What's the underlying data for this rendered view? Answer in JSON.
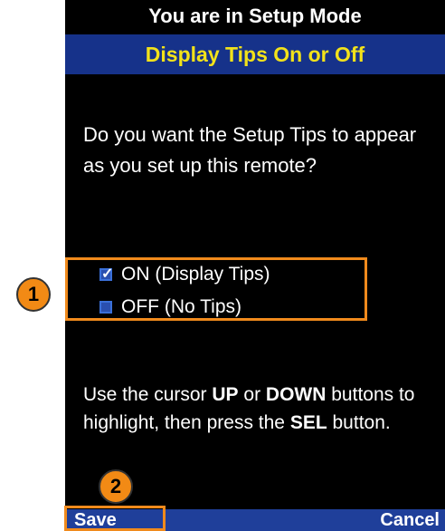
{
  "header": {
    "mode_title": "You are in Setup Mode",
    "screen_title": "Display Tips On or Off"
  },
  "question": "Do you want the Setup Tips to appear as you set up this remote?",
  "options": [
    {
      "label": "ON (Display Tips)",
      "checked": true
    },
    {
      "label": "OFF (No Tips)",
      "checked": false
    }
  ],
  "instructions": {
    "part1": "Use the cursor ",
    "up": "UP",
    "or": " or ",
    "down": "DOWN",
    "part2": " buttons to highlight, then press the ",
    "sel": "SEL",
    "part3": " button."
  },
  "softkeys": {
    "left": "Save",
    "right": "Cancel"
  },
  "callouts": [
    "1",
    "2"
  ],
  "colors": {
    "background": "#000000",
    "title_bar": "#16328a",
    "title_text": "#f2e21a",
    "softkey_bar": "#1f3f9a",
    "highlight": "#f08a1c",
    "badge": "#f28a15"
  }
}
